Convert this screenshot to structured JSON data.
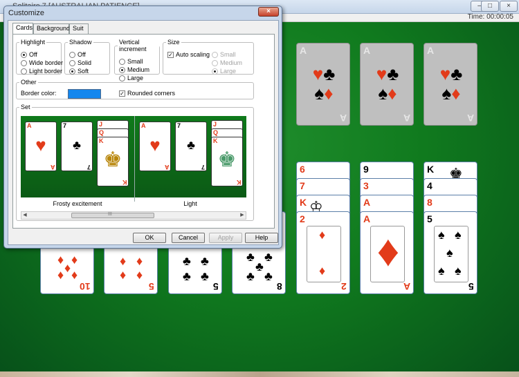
{
  "window": {
    "title": "Solitaire 7 [AUSTRALIAN PATIENCE]",
    "timer": "Time: 00:00:05",
    "controls": [
      "–",
      "□",
      "×"
    ]
  },
  "dialog": {
    "title": "Customize",
    "close_label": "×",
    "tabs": [
      "Cards",
      "Background",
      "Suit"
    ],
    "active_tab": "Cards",
    "highlight": {
      "legend": "Highlight",
      "options": [
        "Off",
        "Wide border",
        "Light border"
      ],
      "selected": "Off"
    },
    "shadow": {
      "legend": "Shadow",
      "options": [
        "Off",
        "Solid",
        "Soft"
      ],
      "selected": "Soft"
    },
    "vertical_increment": {
      "legend": "Vertical increment",
      "options": [
        "Small",
        "Medium",
        "Large"
      ],
      "selected": "Medium"
    },
    "size": {
      "legend": "Size",
      "auto_scaling_label": "Auto scaling",
      "auto_scaling": true,
      "options": [
        "Small",
        "Medium",
        "Large"
      ],
      "selected": "Large"
    },
    "other": {
      "legend": "Other",
      "border_color_label": "Border color:",
      "border_color": "#1487ee",
      "rounded_corners_label": "Rounded corners",
      "rounded_corners": true
    },
    "set": {
      "legend": "Set",
      "items": [
        {
          "name": "Frosty excitement",
          "ranks": [
            "A",
            "7",
            "J",
            "Q",
            "K"
          ]
        },
        {
          "name": "Light",
          "ranks": [
            "A",
            "7",
            "J",
            "Q",
            "K"
          ]
        }
      ],
      "scroll_thumb_label": "III"
    },
    "buttons": {
      "ok": "OK",
      "cancel": "Cancel",
      "apply": "Apply",
      "help": "Help"
    }
  },
  "colors": {
    "table_green": "#107a1e",
    "red_suit": "#e23b1a",
    "placeholder": "#bfbfbf"
  },
  "foundations": [
    {
      "rank": "A",
      "suits": "♥ ♣ ♠ ♦"
    },
    {
      "rank": "A",
      "suits": "♥ ♣ ♠ ♦"
    },
    {
      "rank": "A",
      "suits": "♥ ♣ ♠ ♦"
    }
  ],
  "tableau": {
    "col5_ranks": [
      "6",
      "7",
      "K",
      "2"
    ],
    "col6_ranks": [
      "9",
      "3",
      "A",
      "A"
    ],
    "col7_ranks": [
      "K",
      "4",
      "8",
      "5"
    ],
    "bottom_ranks": [
      "10",
      "5",
      "5",
      "8",
      "2",
      "A",
      "5"
    ]
  },
  "suit_glyphs": {
    "heart": "♥",
    "club": "♣",
    "spade": "♠",
    "diamond": "♦"
  }
}
